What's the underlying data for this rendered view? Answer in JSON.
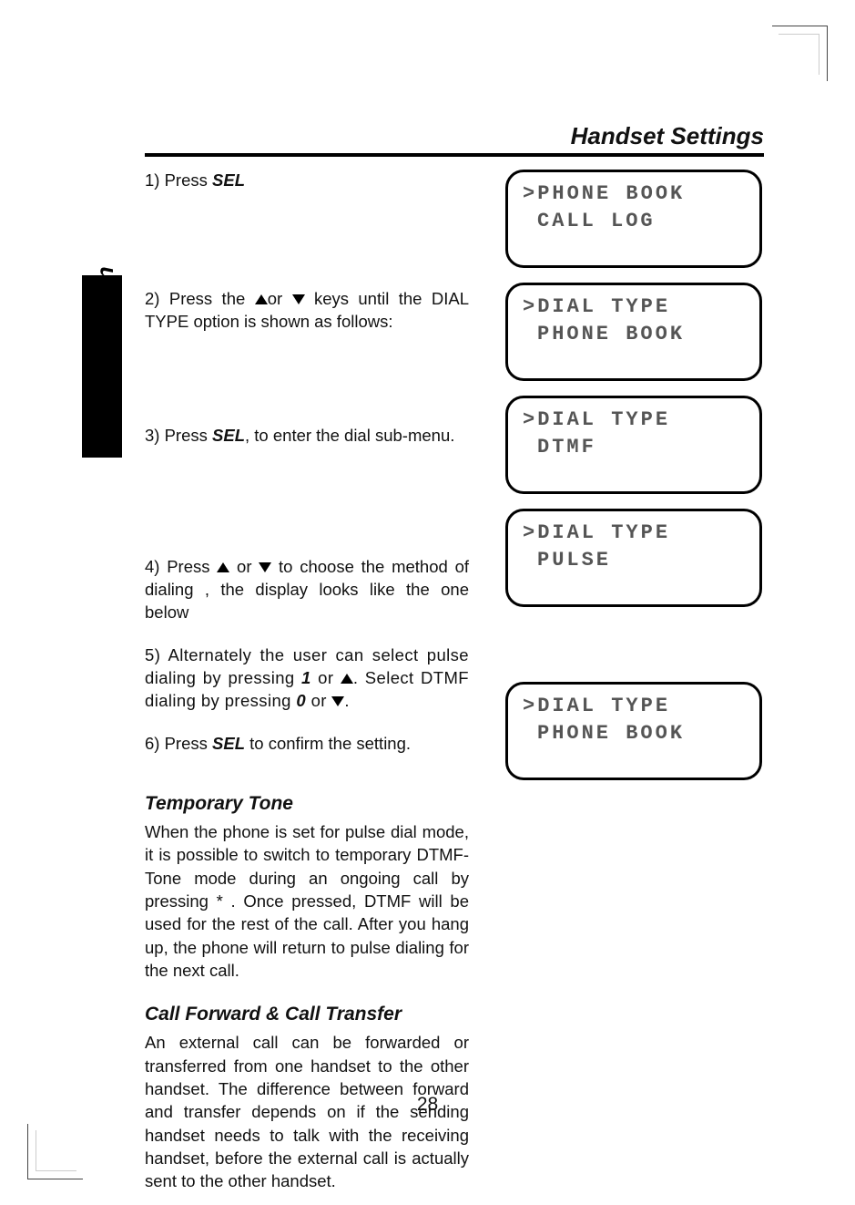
{
  "header": {
    "title": "Handset Settings"
  },
  "sidetab": {
    "label": "Basic Operation"
  },
  "steps": {
    "s1_pre": "1) Press ",
    "s1_b": "SEL",
    "s2_pre": "2) Press the ",
    "s2_mid": "or ",
    "s2_post": " keys until the DIAL TYPE option is shown as follows:",
    "s3_pre": "3) Press ",
    "s3_b": "SEL",
    "s3_post": ", to enter the dial sub-menu.",
    "s4_pre": "4) Press ",
    "s4_mid": " or ",
    "s4_post": " to choose the method of    dialing , the display looks like the one below",
    "s5_pre": "5)  Alternately the user can select pulse dialing by pressing ",
    "s5_i1": "1",
    "s5_mid1": " or ",
    "s5_mid2": ". Select DTMF dialing by pressing  ",
    "s5_i0": "0",
    "s5_mid3": " or ",
    "s5_end": ".",
    "s6_pre": "6) Press ",
    "s6_b": "SEL",
    "s6_post": " to confirm the setting."
  },
  "temp_tone": {
    "heading": "Temporary Tone",
    "body": "When the phone is set for pulse dial mode, it is possible to switch to temporary DTMF-Tone mode during an ongoing call by pressing * . Once pressed, DTMF will be used for the rest of the call.  After you hang up, the phone will return to pulse dialing for the next call."
  },
  "fwd": {
    "heading": "Call Forward & Call Transfer",
    "body": "An external call can be forwarded or transferred from one handset to the other handset. The difference between forward and transfer depends on if the sending handset needs to talk with the receiving handset, before the external call is actually sent to the other handset."
  },
  "lcds": [
    {
      "l1": ">PHONE BOOK",
      "l2": "CALL LOG"
    },
    {
      "l1": ">DIAL TYPE",
      "l2": "PHONE BOOK"
    },
    {
      "l1": ">DIAL TYPE",
      "l2": "DTMF"
    },
    {
      "l1": ">DIAL TYPE",
      "l2": "PULSE"
    },
    {
      "l1": ">DIAL TYPE",
      "l2": "PHONE BOOK"
    }
  ],
  "page_number": "28"
}
